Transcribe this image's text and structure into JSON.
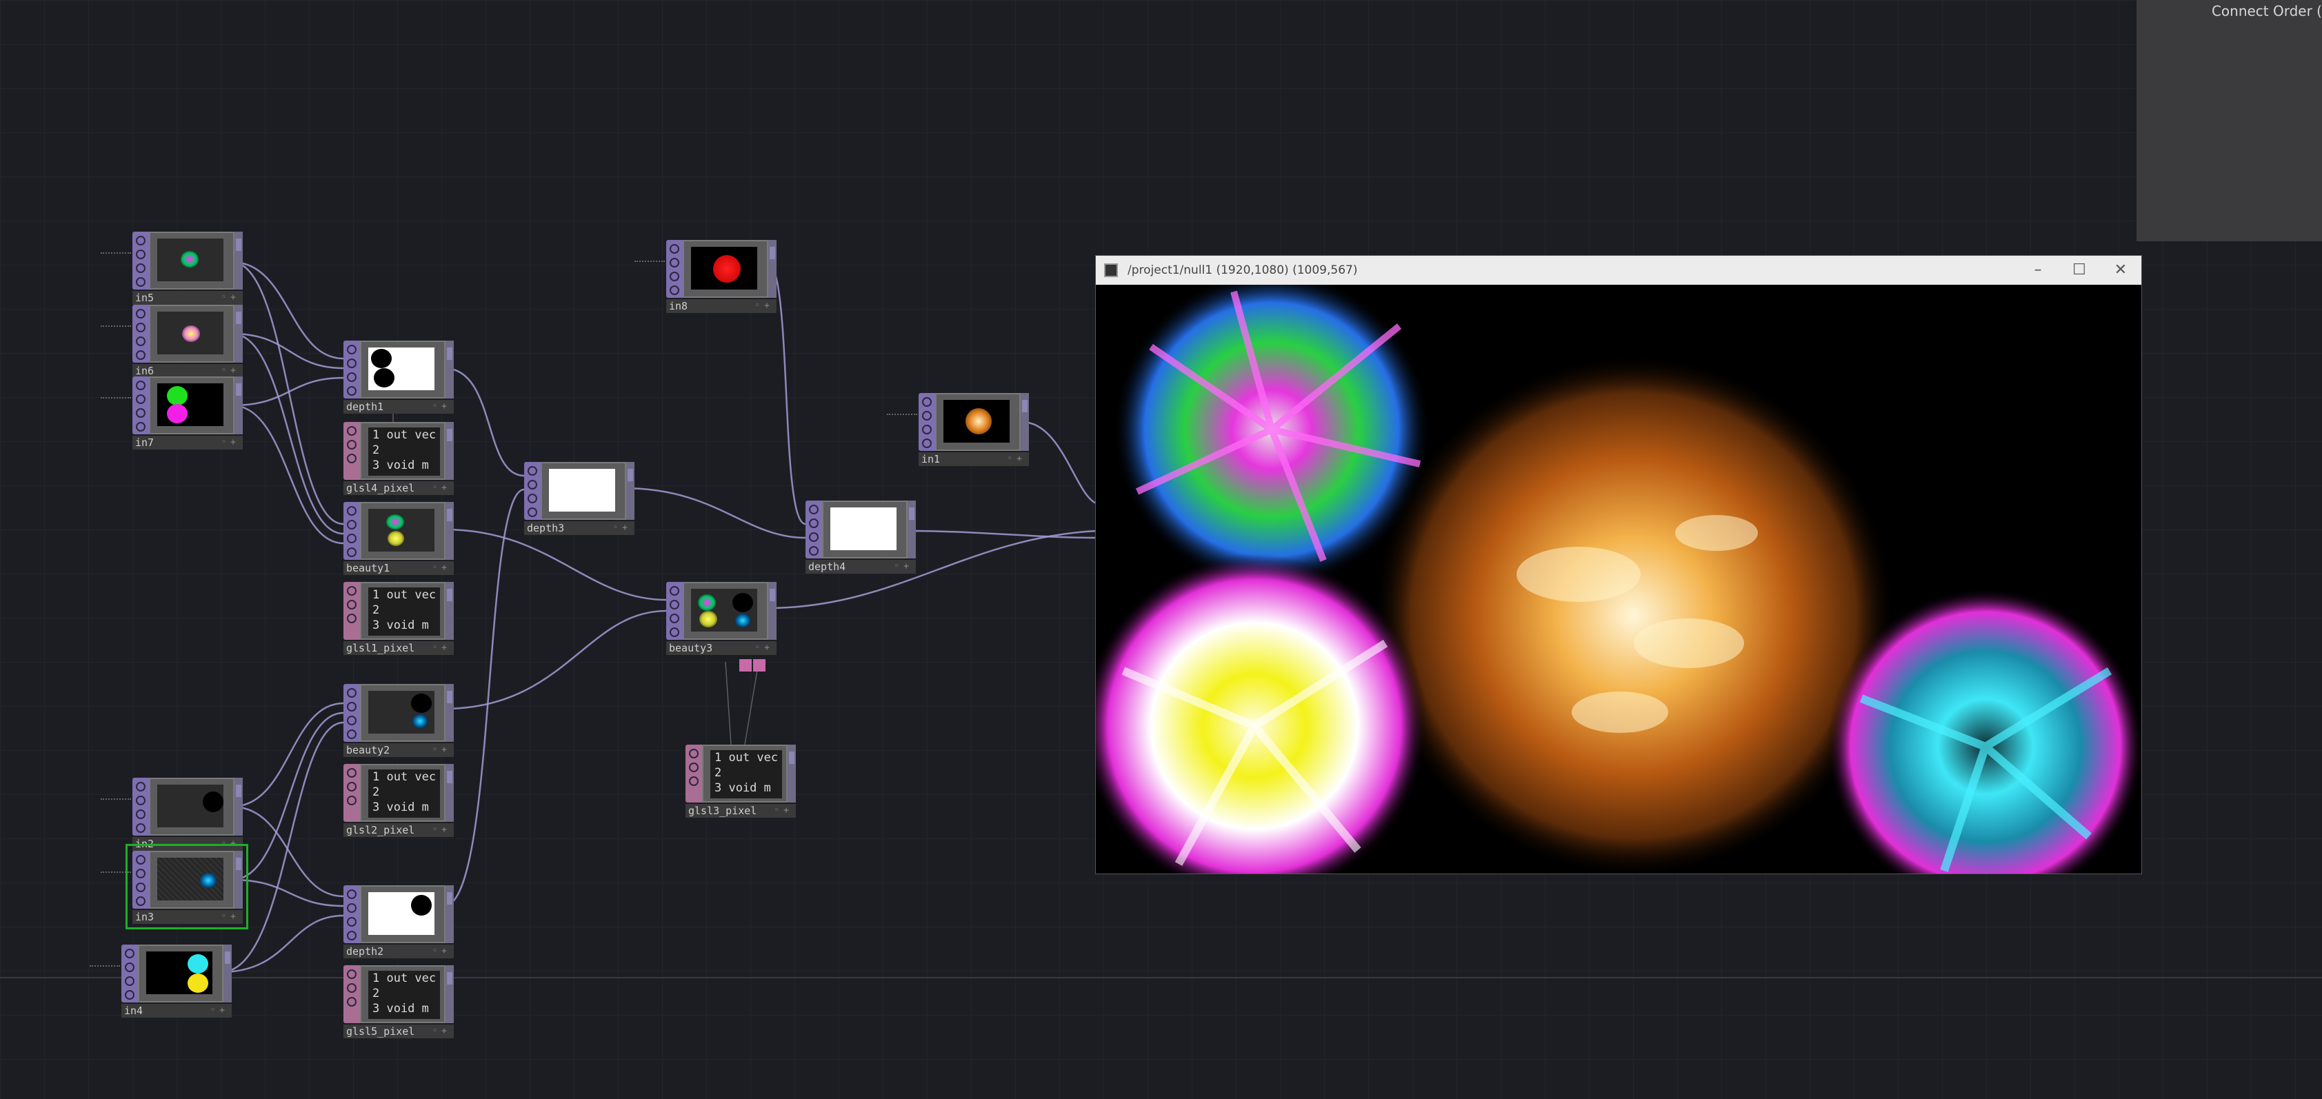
{
  "side_panel": {
    "connect_order": "Connect Order ("
  },
  "viewer": {
    "title": "/project1/null1 (1920,1080) (1009,567)",
    "minimize": "–",
    "maximize": "☐",
    "close": "✕"
  },
  "nodes": {
    "in5": "in5",
    "in6": "in6",
    "in7": "in7",
    "in8": "in8",
    "in1": "in1",
    "in2": "in2",
    "in3": "in3",
    "in4": "in4",
    "depth1": "depth1",
    "depth2": "depth2",
    "depth3": "depth3",
    "depth4": "depth4",
    "beauty1": "beauty1",
    "beauty2": "beauty2",
    "beauty3": "beauty3",
    "glsl14": "glsl4_pixel",
    "glsl11": "glsl1_pixel",
    "glsl12": "glsl2_pixel",
    "glsl15": "glsl5_pixel",
    "glsl13": "glsl3_pixel"
  },
  "code_lines": {
    "l1": "1 out vec",
    "l2": "2",
    "l3": "3 void m"
  },
  "colors": {
    "top_bar": "#7e6fb0",
    "dat_bar": "#a96e94",
    "wire": "#a59ad6",
    "selection": "#1fae2a"
  }
}
